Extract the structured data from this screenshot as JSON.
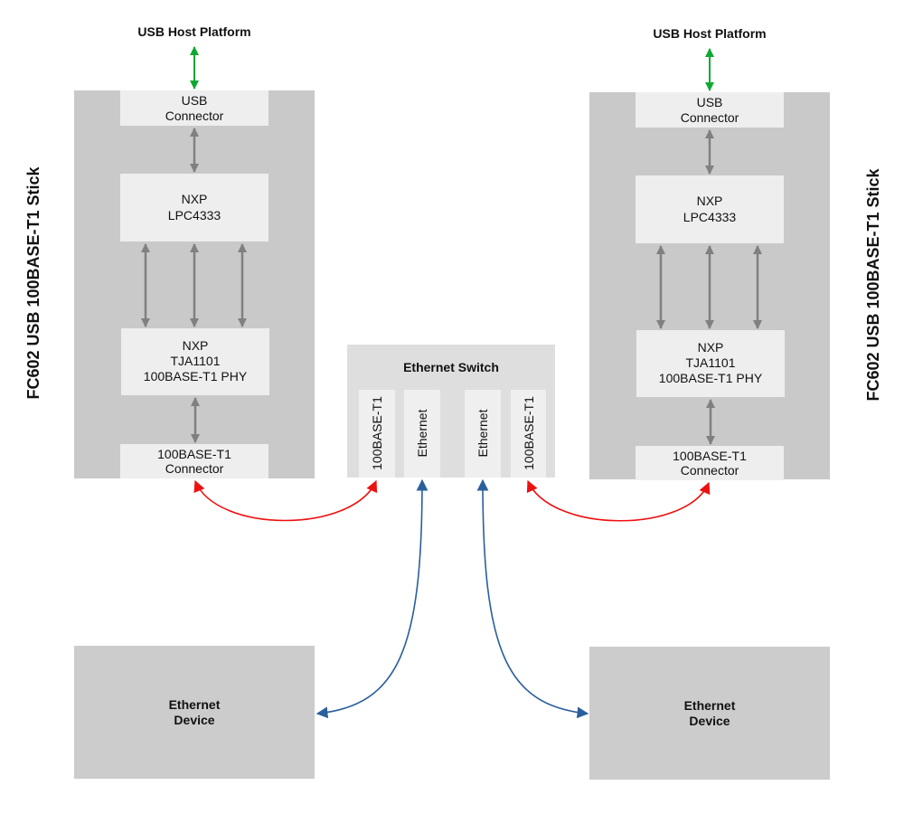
{
  "left_stick": {
    "title": "FC602 USB 100BASE-T1 Stick",
    "host": "USB Host Platform",
    "usb": [
      "USB",
      "Connector"
    ],
    "mcu": [
      "NXP",
      "LPC4333"
    ],
    "phy": [
      "NXP",
      "TJA1101",
      "100BASE-T1 PHY"
    ],
    "connector": [
      "100BASE-T1",
      "Connector"
    ]
  },
  "right_stick": {
    "title": "FC602 USB 100BASE-T1 Stick",
    "host": "USB Host Platform",
    "usb": [
      "USB",
      "Connector"
    ],
    "mcu": [
      "NXP",
      "LPC4333"
    ],
    "phy": [
      "NXP",
      "TJA1101",
      "100BASE-T1 PHY"
    ],
    "connector": [
      "100BASE-T1",
      "Connector"
    ]
  },
  "switch": {
    "title": "Ethernet Switch",
    "ports": [
      "100BASE-T1",
      "Ethernet",
      "Ethernet",
      "100BASE-T1"
    ]
  },
  "devices": [
    {
      "label": [
        "Ethernet",
        "Device"
      ]
    },
    {
      "label": [
        "Ethernet",
        "Device"
      ]
    }
  ],
  "colors": {
    "usb_link": "#10a832",
    "t1_link": "#ee1111",
    "ethernet_link": "#2a5f9c",
    "internal_link": "#808080"
  }
}
